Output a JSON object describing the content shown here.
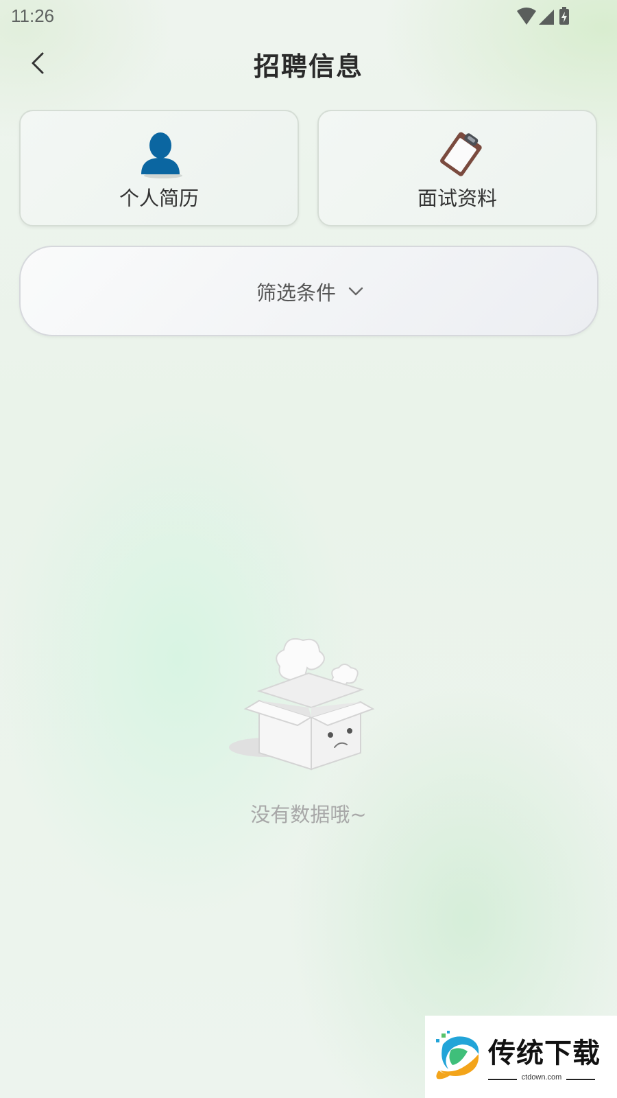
{
  "status_bar": {
    "time": "11:26",
    "icons": [
      "wifi-icon",
      "cellular-signal-icon",
      "battery-charging-icon"
    ]
  },
  "header": {
    "title": "招聘信息",
    "back_icon": "chevron-left-icon"
  },
  "cards": [
    {
      "label": "个人简历",
      "icon": "person-icon",
      "icon_color": "#0b66a1"
    },
    {
      "label": "面试资料",
      "icon": "clipboard-icon",
      "icon_color": "#7a4a3e"
    }
  ],
  "filter": {
    "label": "筛选条件",
    "icon": "chevron-down-icon"
  },
  "empty_state": {
    "icon": "empty-box-icon",
    "message": "没有数据哦~"
  },
  "watermark": {
    "title": "传统下载",
    "url": "ctdown.com"
  }
}
